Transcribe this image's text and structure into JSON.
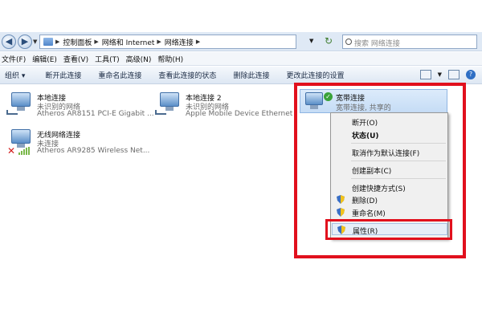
{
  "address": {
    "crumbs": [
      "控制面板",
      "网络和 Internet",
      "网络连接"
    ],
    "search_placeholder": "搜索 网络连接"
  },
  "menu": [
    "文件(F)",
    "编辑(E)",
    "查看(V)",
    "工具(T)",
    "高级(N)",
    "帮助(H)"
  ],
  "commands": [
    "组织 ▾",
    "断开此连接",
    "重命名此连接",
    "查看此连接的状态",
    "删除此连接",
    "更改此连接的设置"
  ],
  "connections": [
    {
      "name": "本地连接",
      "status": "未识别的网络",
      "device": "Atheros AR8151 PCI-E Gigabit ..."
    },
    {
      "name": "本地连接 2",
      "status": "未识别的网络",
      "device": "Apple Mobile Device Ethernet"
    },
    {
      "name": "无线网络连接",
      "status": "未连接",
      "device": "Atheros AR9285 Wireless Net..."
    }
  ],
  "broadband": {
    "name": "宽带连接",
    "status": "宽带连接, 共享的"
  },
  "context_menu": {
    "disconnect": "断开(O)",
    "status": "状态(U)",
    "cancel_default": "取消作为默认连接(F)",
    "create_copy": "创建副本(C)",
    "create_shortcut": "创建快捷方式(S)",
    "delete": "删除(D)",
    "rename": "重命名(M)",
    "properties": "属性(R)"
  },
  "colors": {
    "annotation_red": "#e1101d",
    "selection_blue": "#c5dcf5"
  }
}
